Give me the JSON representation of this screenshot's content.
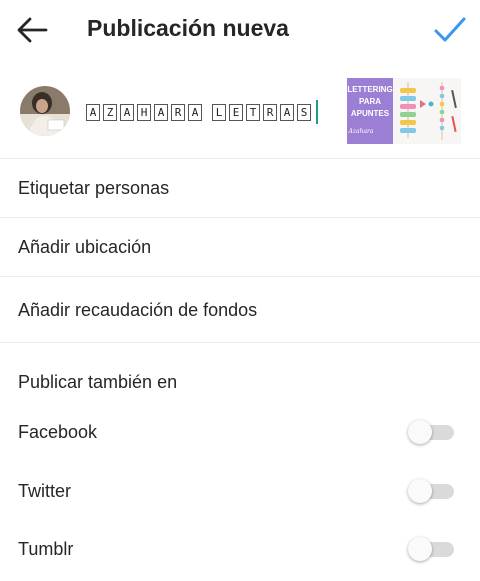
{
  "header": {
    "title": "Publicación nueva",
    "back_icon": "arrow-left-icon",
    "confirm_icon": "checkmark-icon",
    "accent_color": "#3897f0"
  },
  "compose": {
    "caption_letters": [
      "A",
      "Z",
      "A",
      "H",
      "A",
      "R",
      "A",
      " ",
      "L",
      "E",
      "T",
      "R",
      "A",
      "S"
    ],
    "thumbnail": {
      "line1": "LETTERING",
      "line2": "PARA",
      "line3": "APUNTES",
      "signature": "Azahara",
      "color": "#9b7fd4"
    }
  },
  "options": {
    "tag_people": "Etiquetar personas",
    "add_location": "Añadir ubicación",
    "add_fundraiser": "Añadir recaudación de fondos"
  },
  "share": {
    "heading": "Publicar también en",
    "items": [
      {
        "label": "Facebook",
        "enabled": false
      },
      {
        "label": "Twitter",
        "enabled": false
      },
      {
        "label": "Tumblr",
        "enabled": false
      }
    ]
  }
}
